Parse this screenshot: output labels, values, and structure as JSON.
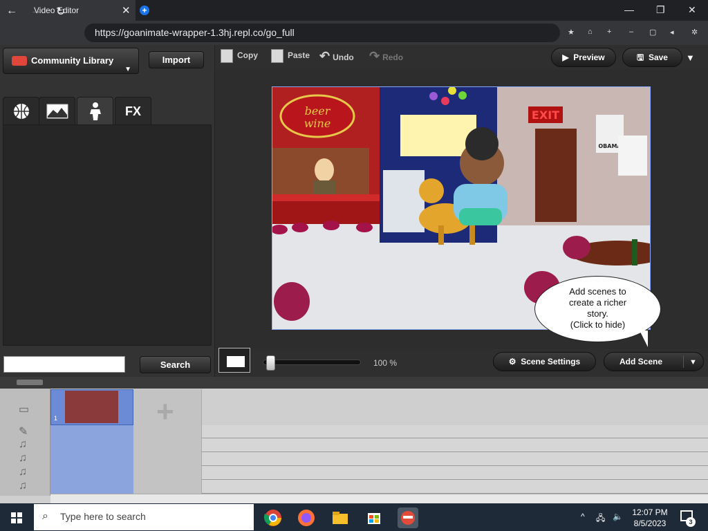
{
  "browser": {
    "tab_title": "Video Editor",
    "url": "https://goanimate-wrapper-1.3hj.repl.co/go_full"
  },
  "library": {
    "dropdown_label": "Community Library",
    "import_label": "Import",
    "tabs": [
      "basketball-icon",
      "landscape-icon",
      "character-icon",
      "FX"
    ],
    "fx_label": "FX",
    "search_placeholder": "",
    "search_label": "Search"
  },
  "editor_toolbar": {
    "copy": "Copy",
    "paste": "Paste",
    "undo": "Undo",
    "redo": "Redo",
    "preview": "Preview",
    "save": "Save"
  },
  "stage": {
    "bubble_lines": [
      "Add scenes to",
      "create a richer",
      "story.",
      "(Click to hide)"
    ],
    "sign_beer": "beer wine",
    "sign_exit": "EXIT",
    "poster_text": "OBAMA"
  },
  "zoom": {
    "value_label": "100 %",
    "level": 1.0
  },
  "scene_controls": {
    "settings_label": "Scene Settings",
    "add_label": "Add Scene"
  },
  "timeline": {
    "scene_number": "1"
  },
  "taskbar": {
    "search_placeholder": "Type here to search",
    "time": "12:07 PM",
    "date": "8/5/2023",
    "notification_count": "3"
  }
}
